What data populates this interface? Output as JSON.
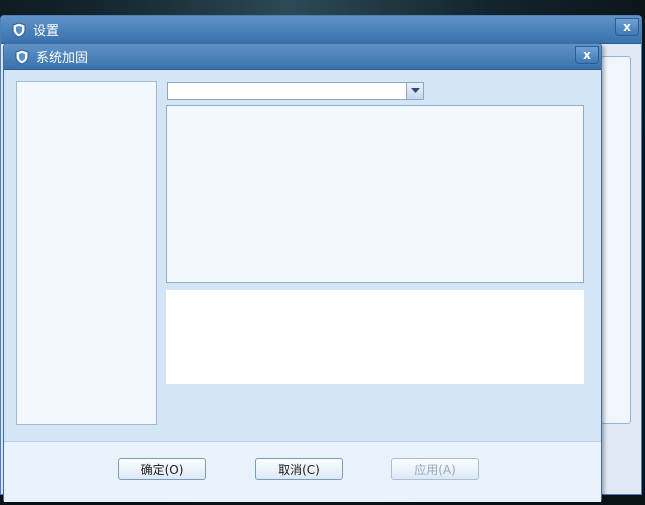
{
  "settings_window": {
    "title": "设置",
    "close_label": "x"
  },
  "system_window": {
    "title": "系统加固",
    "close_label": "x"
  },
  "dropdown": {
    "value": ""
  },
  "buttons": {
    "ok": "确定(O)",
    "cancel": "取消(C)",
    "apply": "应用(A)"
  }
}
